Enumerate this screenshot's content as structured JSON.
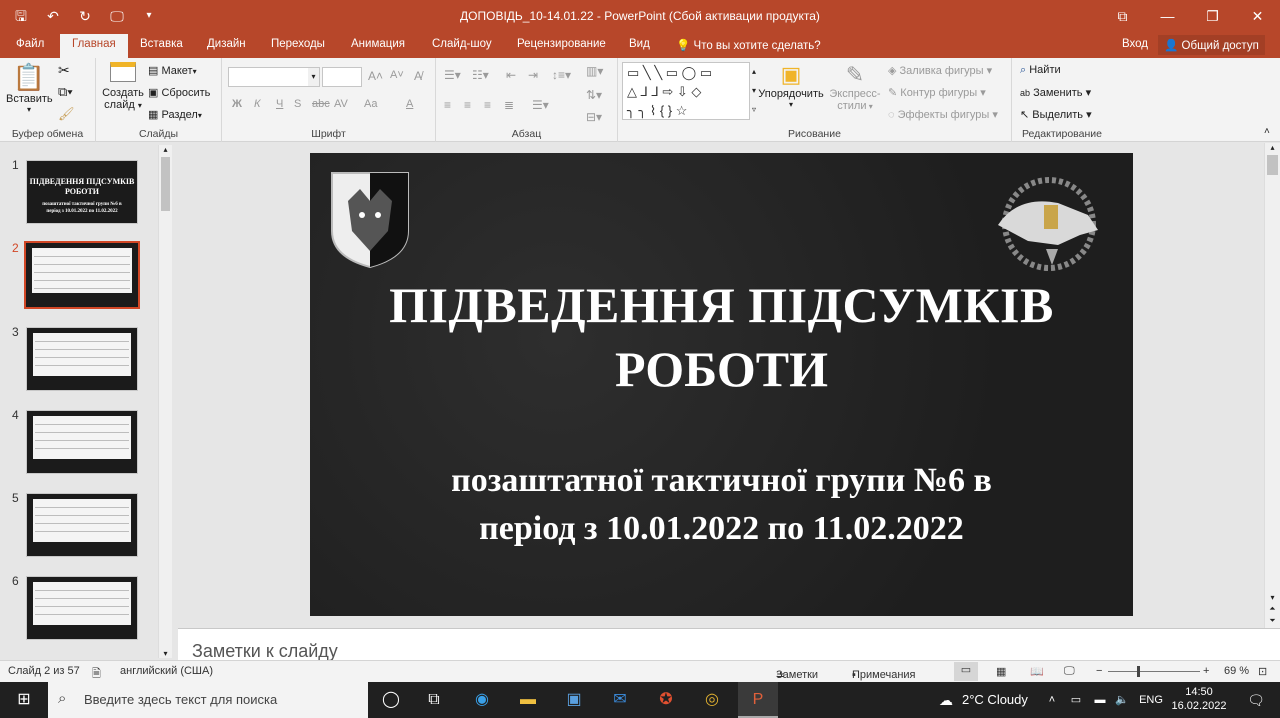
{
  "window": {
    "title": "ДОПОВІДЬ_10-14.01.22 - PowerPoint (Сбой активации продукта)",
    "controls": [
      "⧉",
      "—",
      "❐",
      "✕"
    ]
  },
  "qat": [
    "🖫",
    "↶",
    "↻",
    "🖵",
    "▾"
  ],
  "tabs": [
    "Файл",
    "Главная",
    "Вставка",
    "Дизайн",
    "Переходы",
    "Анимация",
    "Слайд-шоу",
    "Рецензирование",
    "Вид"
  ],
  "tell_me": "Что вы хотите сделать?",
  "signin": "Вход",
  "share": "Общий доступ",
  "ribbon": {
    "clipboard": {
      "label": "Буфер обмена",
      "paste": "Вставить"
    },
    "slides": {
      "label": "Слайды",
      "new_slide_1": "Создать",
      "new_slide_2": "слайд",
      "layout": "Макет",
      "reset": "Сбросить",
      "section": "Раздел"
    },
    "font": {
      "label": "Шрифт",
      "bold": "Ж",
      "italic": "К",
      "underline": "Ч",
      "strike": "S",
      "shadow": "abc",
      "spacing": "AV",
      "case": "Aa",
      "color": "A"
    },
    "paragraph": {
      "label": "Абзац"
    },
    "drawing": {
      "label": "Рисование",
      "arrange": "Упорядочить",
      "styles_1": "Экспресс-",
      "styles_2": "стили",
      "fill": "Заливка фигуры",
      "outline": "Контур фигуры",
      "effects": "Эффекты фигуры"
    },
    "editing": {
      "label": "Редактирование",
      "find": "Найти",
      "replace": "Заменить",
      "select": "Выделить"
    }
  },
  "thumbnails": {
    "numbers": [
      "1",
      "2",
      "3",
      "4",
      "5",
      "6"
    ],
    "t1_title": "ПІДВЕДЕННЯ ПІДСУМКІВ РОБОТИ",
    "t1_sub": "позаштатної тактичної групи №6 в період з 10.01.2022 по 11.02.2022",
    "selected": 2
  },
  "slide": {
    "title_line1": "ПІДВЕДЕННЯ ПІДСУМКІВ",
    "title_line2": "РОБОТИ",
    "sub_line1": "позаштатної тактичної групи №6 в",
    "sub_line2": "період з 10.01.2022 по 11.02.2022"
  },
  "notes_placeholder": "Заметки к слайду",
  "status": {
    "slide_info": "Слайд 2 из 57",
    "language": "английский (США)",
    "notes": "Заметки",
    "comments": "Примечания",
    "zoom": "69 %",
    "zoom_level": 0.69
  },
  "taskbar": {
    "search_placeholder": "Введите здесь текст для поиска",
    "weather": "2°C  Cloudy",
    "lang": "ENG",
    "time": "14:50",
    "date": "16.02.2022"
  },
  "colors": {
    "accent": "#b7472a",
    "selection": "#d24726",
    "slide_bg": "#262626"
  }
}
